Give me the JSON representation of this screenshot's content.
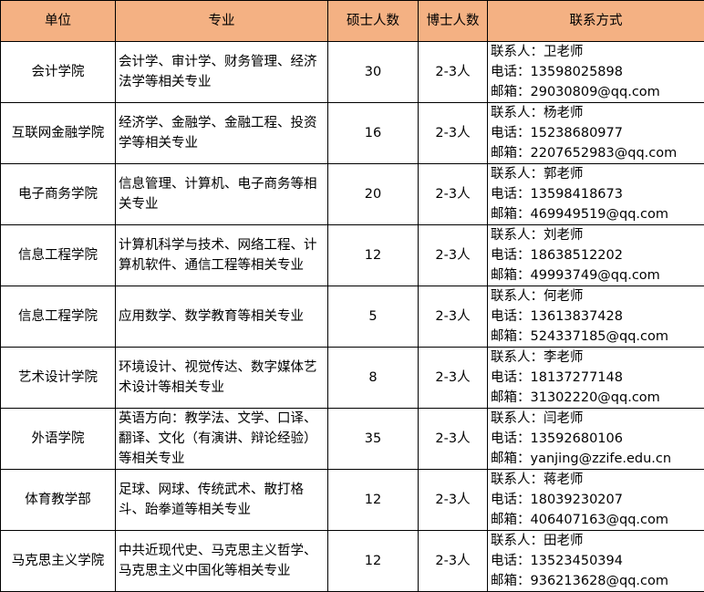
{
  "headers": {
    "unit": "单位",
    "major": "专业",
    "masters": "硕士人数",
    "phd": "博士人数",
    "contact": "联系方式"
  },
  "rows": [
    {
      "unit": "会计学院",
      "major": "会计学、审计学、财务管理、经济法学等相关专业",
      "masters": "30",
      "phd": "2-3人",
      "contact_person": "联系人：卫老师",
      "phone": "电话：13598025898",
      "email": "邮箱：29030809@qq.com"
    },
    {
      "unit": "互联网金融学院",
      "major": "经济学、金融学、金融工程、投资学等相关专业",
      "masters": "16",
      "phd": "2-3人",
      "contact_person": "联系人：杨老师",
      "phone": "电话：15238680977",
      "email": "邮箱：2207652983@qq.com"
    },
    {
      "unit": "电子商务学院",
      "major": "信息管理、计算机、电子商务等相关专业",
      "masters": "20",
      "phd": "2-3人",
      "contact_person": "联系人：郭老师",
      "phone": "电话：13598418673",
      "email": "邮箱：469949519@qq.com"
    },
    {
      "unit": "信息工程学院",
      "major": "计算机科学与技术、网络工程、计算机软件、通信工程等相关专业",
      "masters": "12",
      "phd": "2-3人",
      "contact_person": "联系人：刘老师",
      "phone": "电话：18638512202",
      "email": "邮箱：49993749@qq.com"
    },
    {
      "unit": "信息工程学院",
      "major": "应用数学、数学教育等相关专业",
      "masters": "5",
      "phd": "2-3人",
      "contact_person": "联系人：何老师",
      "phone": "电话：13613837428",
      "email": "邮箱：524337185@qq.com"
    },
    {
      "unit": "艺术设计学院",
      "major": "环境设计、视觉传达、数字媒体艺术设计等相关专业",
      "masters": "8",
      "phd": "2-3人",
      "contact_person": "联系人：李老师",
      "phone": "电话：18137277148",
      "email": "邮箱：31302220@qq.com"
    },
    {
      "unit": "外语学院",
      "major": "英语方向：教学法、文学、口译、翻译、文化（有演讲、辩论经验）等相关专业",
      "masters": "35",
      "phd": "2-3人",
      "contact_person": "联系人：闫老师",
      "phone": "电话：13592680106",
      "email": "邮箱：yanjing@zzife.edu.cn"
    },
    {
      "unit": "体育教学部",
      "major": "足球、网球、传统武术、散打格斗、跆拳道等相关专业",
      "masters": "12",
      "phd": "2-3人",
      "contact_person": "联系人：蒋老师",
      "phone": "电话：18039230207",
      "email": "邮箱：406407163@qq.com"
    },
    {
      "unit": "马克思主义学院",
      "major": "中共近现代史、马克思主义哲学、马克思主义中国化等相关专业",
      "masters": "12",
      "phd": "2-3人",
      "contact_person": "联系人：田老师",
      "phone": "电话：13523450394",
      "email": "邮箱：936213628@qq.com"
    }
  ]
}
